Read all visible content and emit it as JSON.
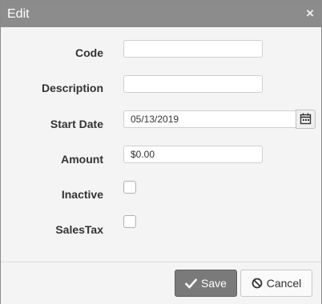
{
  "dialog": {
    "title": "Edit",
    "close_glyph": "×"
  },
  "form": {
    "code": {
      "label": "Code",
      "value": ""
    },
    "description": {
      "label": "Description",
      "value": ""
    },
    "start_date": {
      "label": "Start Date",
      "value": "05/13/2019",
      "icon": "calendar-icon"
    },
    "amount": {
      "label": "Amount",
      "value": "$0.00"
    },
    "inactive": {
      "label": "Inactive",
      "checked": false
    },
    "sales_tax": {
      "label": "SalesTax",
      "checked": false
    }
  },
  "footer": {
    "save_label": "Save",
    "save_icon": "checkmark-icon",
    "cancel_label": "Cancel",
    "cancel_icon": "ban-icon"
  },
  "colors": {
    "titlebar": "#8c8c8c",
    "save_button": "#7a7a7a"
  }
}
